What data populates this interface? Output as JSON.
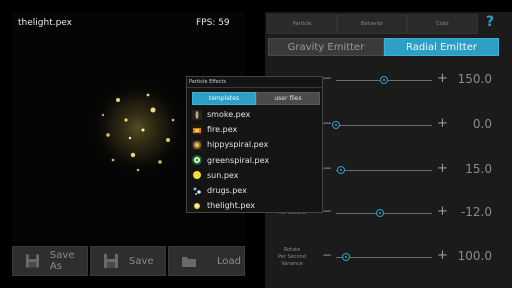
{
  "preview": {
    "title": "thelight.pex",
    "fps": "FPS: 59"
  },
  "bottom_buttons": [
    {
      "label": "Save As",
      "icon": "save-as-icon"
    },
    {
      "label": "Save",
      "icon": "save-icon"
    },
    {
      "label": "Load",
      "icon": "folder-icon"
    }
  ],
  "top_tabs": [
    "Particle",
    "Behavior",
    "Color"
  ],
  "help_label": "?",
  "emitters": {
    "gravity": "Gravity Emitter",
    "radial": "Radial Emitter",
    "selected": "radial"
  },
  "rows": [
    {
      "label": "",
      "value": "150.0",
      "level": 0.5
    },
    {
      "label": "",
      "value": "0.0",
      "level": 0.0
    },
    {
      "label": "",
      "value": "15.0",
      "level": 0.05
    },
    {
      "label": "Per Second",
      "value": "-12.0",
      "level": 0.46
    },
    {
      "label": "Rotate\nPer Second\nVariance",
      "value": "100.0",
      "level": 0.1
    }
  ],
  "dialog": {
    "title": "Particle Effects",
    "tabs": [
      "templates",
      "user files"
    ],
    "selected_tab": "templates",
    "files": [
      {
        "name": "smoke.pex",
        "icon": "smoke-icon"
      },
      {
        "name": "fire.pex",
        "icon": "fire-icon"
      },
      {
        "name": "hippyspiral.pex",
        "icon": "hippyspiral-icon"
      },
      {
        "name": "greenspiral.pex",
        "icon": "greenspiral-icon"
      },
      {
        "name": "sun.pex",
        "icon": "sun-icon"
      },
      {
        "name": "drugs.pex",
        "icon": "drugs-icon"
      },
      {
        "name": "thelight.pex",
        "icon": "thelight-icon"
      }
    ]
  },
  "colors": {
    "accent": "#2e9fc4",
    "panel": "#1b1b1b",
    "button": "#2e2e2e"
  }
}
